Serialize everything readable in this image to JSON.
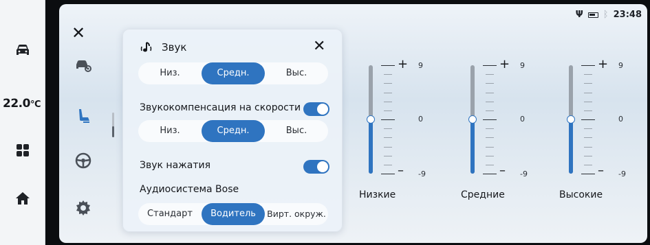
{
  "left_bar": {
    "temperature_value": "22.0",
    "temperature_unit": "°C",
    "icons": [
      "car-icon",
      "grid-icon",
      "home-icon"
    ]
  },
  "status_bar": {
    "time": "23:48",
    "icons": [
      "usb-icon",
      "battery-icon",
      "bluetooth-icon"
    ]
  },
  "side_menu": {
    "close_icon": "close-icon",
    "items": [
      "car-settings-icon",
      "seat-icon",
      "steering-wheel-icon",
      "gear-icon"
    ],
    "active_item": "seat-icon"
  },
  "sound_panel": {
    "title": "Звук",
    "bass_level": {
      "options": [
        "Низ.",
        "Средн.",
        "Выс."
      ],
      "selected": "Средн."
    },
    "speed_comp": {
      "label": "Звукокомпенсация на скорости",
      "enabled": true,
      "options": [
        "Низ.",
        "Средн.",
        "Выс."
      ],
      "selected": "Средн."
    },
    "key_sound": {
      "label": "Звук нажатия",
      "enabled": true
    },
    "bose": {
      "label": "Аудиосистема Bose",
      "options": [
        "Стандарт",
        "Водитель",
        "Вирт. окруж."
      ],
      "selected": "Водитель"
    }
  },
  "equalizer": {
    "max_label": "9",
    "mid_label": "0",
    "min_label": "-9",
    "plus_sign": "+",
    "minus_sign": "–",
    "bands": [
      {
        "name": "Низкие",
        "value": 0
      },
      {
        "name": "Средние",
        "value": 0
      },
      {
        "name": "Высокие",
        "value": 0
      }
    ],
    "accent_color": "#2f74c0"
  }
}
